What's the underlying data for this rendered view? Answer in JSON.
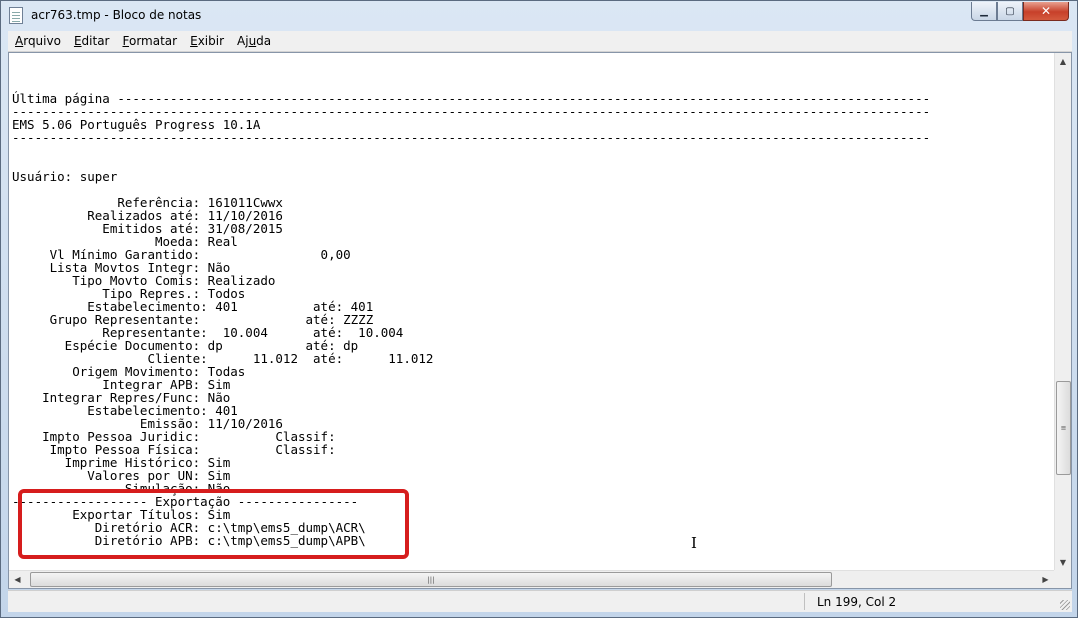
{
  "window": {
    "title": "acr763.tmp - Bloco de notas",
    "controls": {
      "minimize": "▁",
      "maximize": "▢",
      "close": "✕"
    }
  },
  "menu": [
    {
      "mnemonic": "A",
      "rest": "rquivo"
    },
    {
      "mnemonic": "E",
      "rest": "ditar"
    },
    {
      "mnemonic": "F",
      "rest": "ormatar"
    },
    {
      "mnemonic": "E",
      "rest": "xibir"
    },
    {
      "pre": "Aj",
      "mnemonic": "u",
      "rest": "da"
    }
  ],
  "document": {
    "lines": [
      "",
      "",
      "",
      "Última página ------------------------------------------------------------------------------------------------------------",
      "--------------------------------------------------------------------------------------------------------------------------",
      "EMS 5.06 Português Progress 10.1A",
      "--------------------------------------------------------------------------------------------------------------------------",
      "",
      "",
      "Usuário: super",
      "",
      "              Referência: 161011Cwwx",
      "          Realizados até: 11/10/2016",
      "            Emitidos até: 31/08/2015",
      "                   Moeda: Real",
      "     Vl Mínimo Garantido:                0,00",
      "     Lista Movtos Integr: Não",
      "        Tipo Movto Comis: Realizado",
      "            Tipo Repres.: Todos",
      "          Estabelecimento: 401          até: 401",
      "     Grupo Representante:              até: ZZZZ",
      "            Representante:  10.004      até:  10.004",
      "       Espécie Documento: dp           até: dp",
      "                  Cliente:      11.012  até:      11.012",
      "        Origem Movimento: Todas",
      "            Integrar APB: Sim",
      "    Integrar Repres/Func: Não",
      "          Estabelecimento: 401",
      "                 Emissão: 11/10/2016",
      "    Impto Pessoa Juridic:          Classif:",
      "     Impto Pessoa Física:          Classif:",
      "       Imprime Histórico: Sim",
      "          Valores por UN: Sim",
      "               Simulação: Não",
      "------------------ Exportação ----------------",
      "        Exportar Títulos: Sim",
      "           Diretório ACR: c:\\tmp\\ems5_dump\\ACR\\",
      "           Diretório APB: c:\\tmp\\ems5_dump\\APB\\"
    ]
  },
  "scrollbars": {
    "up_arrow": "▲",
    "down_arrow": "▼",
    "left_arrow": "◀",
    "right_arrow": "▶",
    "grip": "≡",
    "hgrip": "|||"
  },
  "status": {
    "position": "Ln 199, Col 2"
  },
  "cursor": "I",
  "colors": {
    "highlight": "#d61d1d"
  }
}
